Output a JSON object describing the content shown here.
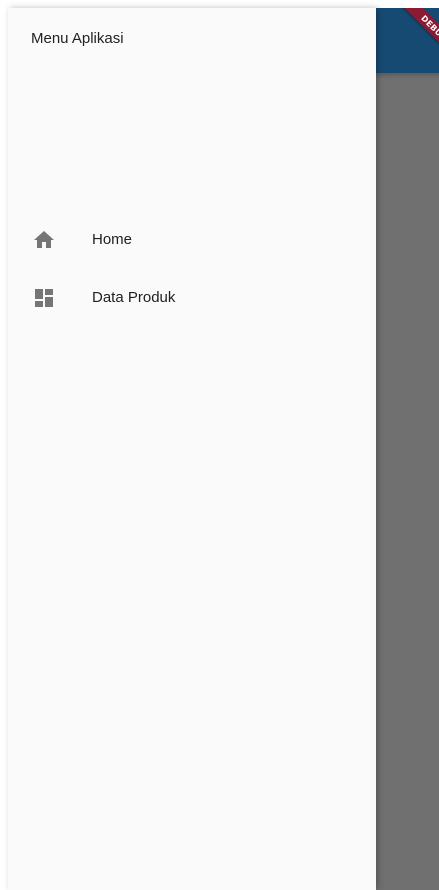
{
  "drawer": {
    "title": "Menu Aplikasi",
    "items": [
      {
        "label": "Home",
        "icon": "home-icon"
      },
      {
        "label": "Data Produk",
        "icon": "dashboard-icon"
      }
    ]
  },
  "debug_banner": {
    "text": "DEBUG",
    "color": "#8b1a32"
  },
  "colors": {
    "drawer_bg": "#fafafa",
    "scrim": "#707070",
    "appbar": "#174a73",
    "icon": "#757575"
  }
}
